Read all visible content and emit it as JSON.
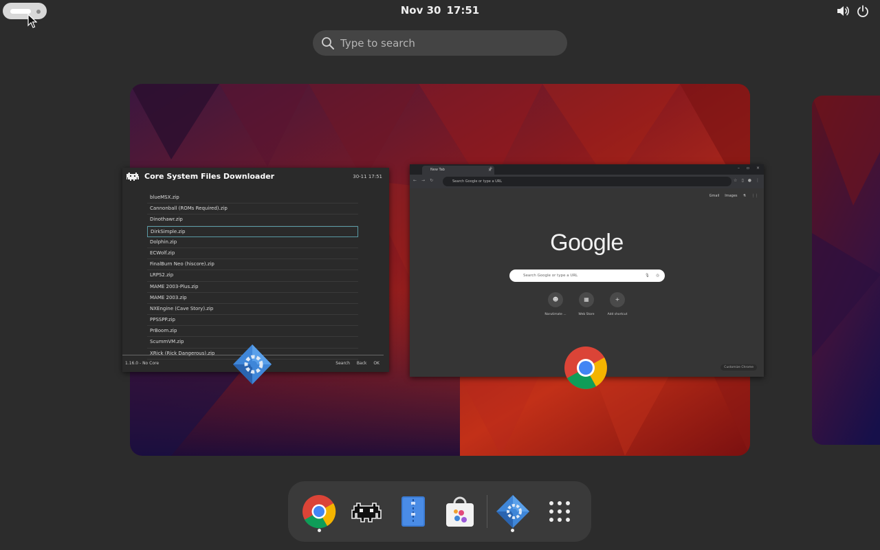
{
  "topbar": {
    "date": "Nov 30",
    "time": "17:51"
  },
  "search": {
    "placeholder": "Type to search"
  },
  "retroarch": {
    "title": "Core System Files Downloader",
    "datetime": "30-11 17:51",
    "items": [
      "blueMSX.zip",
      "Cannonball (ROMs Required).zip",
      "Dinothawr.zip",
      "DirkSimple.zip",
      "Dolphin.zip",
      "ECWolf.zip",
      "FinalBurn Neo (hiscore).zip",
      "LRPS2.zip",
      "MAME 2003-Plus.zip",
      "MAME 2003.zip",
      "NXEngine (Cave Story).zip",
      "PPSSPP.zip",
      "PrBoom.zip",
      "ScummVM.zip",
      "XRick (Rick Dangerous).zip"
    ],
    "selected_index": 3,
    "version": "1.16.0 - No Core",
    "controls": {
      "search": "Search",
      "back": "Back",
      "ok": "OK"
    }
  },
  "chrome": {
    "tab_title": "New Tab",
    "omnibox_placeholder": "Search Google or type a URL",
    "links": {
      "gmail": "Gmail",
      "images": "Images"
    },
    "logo": "Google",
    "search_placeholder": "Search Google or type a URL",
    "shortcuts": [
      {
        "label": "Narutimate ..."
      },
      {
        "label": "Web Store"
      },
      {
        "label": "Add shortcut"
      }
    ],
    "customize_label": "Customize Chrome"
  },
  "dock": {
    "apps": [
      {
        "name": "Google Chrome",
        "running": true
      },
      {
        "name": "RetroArch",
        "running": false
      },
      {
        "name": "Text Editor",
        "running": false
      },
      {
        "name": "Software",
        "running": false
      },
      {
        "name": "Software Updater",
        "running": true
      },
      {
        "name": "Show Apps",
        "running": false
      }
    ]
  },
  "colors": {
    "background": "#2c2c2c",
    "dock": "#3a3a3a",
    "selection_border": "#5a9aa4"
  }
}
